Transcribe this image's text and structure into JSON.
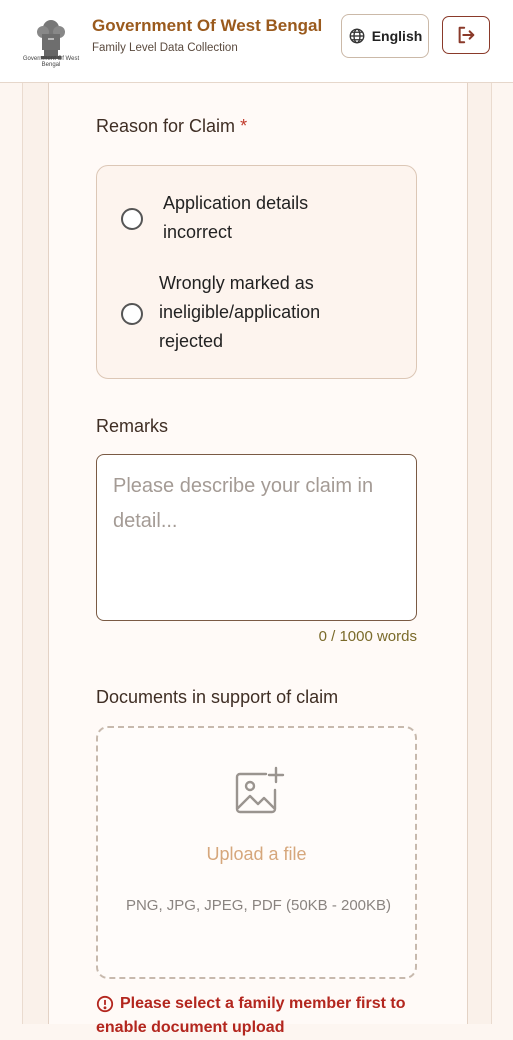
{
  "header": {
    "emblem_caption": "Government Of West Bengal",
    "title": "Government Of West Bengal",
    "subtitle": "Family Level Data Collection",
    "language": "English",
    "icons": {
      "language": "globe-icon",
      "logout": "logout-icon"
    }
  },
  "claim": {
    "reason_label": "Reason for Claim",
    "required_mark": "*",
    "options": [
      {
        "label_line1": "Application details",
        "label_line2": "incorrect"
      },
      {
        "label_line1": "Wrongly marked as",
        "label_line2": "ineligible/application",
        "label_line3": "rejected"
      }
    ],
    "remarks_label": "Remarks",
    "remarks_placeholder": "Please describe your claim in detail...",
    "word_counter": "0 / 1000 words",
    "documents_label": "Documents in support of claim",
    "upload_label": "Upload a file",
    "upload_hint": "PNG, JPG, JPEG, PDF (50KB - 200KB)",
    "error_text": "Please select a family member first to enable document upload"
  },
  "colors": {
    "accent": "#9a5a1d",
    "error": "#b3261e",
    "background": "#fdf6f1"
  }
}
